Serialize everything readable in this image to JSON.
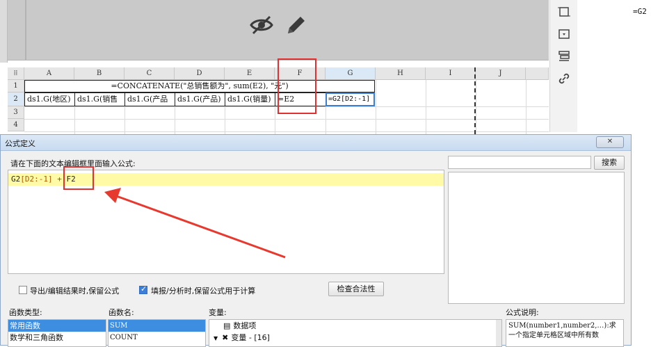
{
  "designer": {
    "hide_icon": "eye-off-icon",
    "edit_icon": "pencil-icon",
    "formula_preview": "=G2"
  },
  "right_toolbar": {
    "icons": [
      "square-frame-icon",
      "dropdown-box-icon",
      "list-layout-icon",
      "link-icon"
    ]
  },
  "sheet": {
    "columns": [
      "A",
      "B",
      "C",
      "D",
      "E",
      "F",
      "G",
      "H",
      "I",
      "J"
    ],
    "rows": [
      "1",
      "2",
      "3",
      "4"
    ],
    "title_formula": "=CONCATENATE(\"总销售额为\", sum(E2), \"元\")",
    "row2": [
      "ds1.G(地区)",
      "ds1.G(销售",
      "ds1.G(产品",
      "ds1.G(产品)",
      "ds1.G(销量)",
      "=E2"
    ],
    "g2": "=G2[D2:-1]"
  },
  "dialog": {
    "title": "公式定义",
    "close_label": "✕",
    "editor_label": "请在下面的文本编辑框里面输入公式:",
    "formula": {
      "ref": "G2",
      "bracket": "[D2:-1]",
      "op": "+",
      "ref2": "F2"
    },
    "search_placeholder": "",
    "search_label": "搜索",
    "option_export": "导出/编辑结果时,保留公式",
    "option_export_checked": false,
    "option_fill": "填报/分析时,保留公式用于计算",
    "option_fill_checked": true,
    "validate_label": "检查合法性",
    "func_type_label": "函数类型:",
    "func_types": [
      "常用函数",
      "数学和三角函数"
    ],
    "func_name_label": "函数名:",
    "func_names": [
      "SUM",
      "COUNT"
    ],
    "var_label": "变量:",
    "vars": [
      "数据项",
      "变量 - [16]"
    ],
    "desc_label": "公式说明:",
    "desc_text": "SUM(number1,number2,…):求一个指定单元格区域中所有数"
  }
}
